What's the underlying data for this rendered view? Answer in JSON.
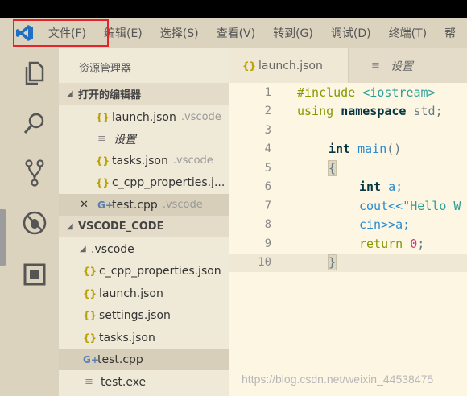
{
  "menu": {
    "items": [
      "文件(F)",
      "编辑(E)",
      "选择(S)",
      "查看(V)",
      "转到(G)",
      "调试(D)",
      "终端(T)",
      "帮"
    ]
  },
  "sidebar": {
    "title": "资源管理器",
    "open_editors_section": "打开的编辑器",
    "open_editors": [
      {
        "icon": "json-icon",
        "name": "launch.json",
        "folder": ".vscode"
      },
      {
        "icon": "settings-file-icon",
        "name": "设置",
        "folder": ""
      },
      {
        "icon": "json-icon",
        "name": "tasks.json",
        "folder": ".vscode"
      },
      {
        "icon": "json-icon",
        "name": "c_cpp_properties.j...",
        "folder": ""
      },
      {
        "icon": "cpp-icon",
        "name": "test.cpp",
        "folder": ".vscode"
      }
    ],
    "workspace_section": "VSCODE_CODE",
    "tree": [
      {
        "name": ".vscode"
      },
      {
        "icon": "json-icon",
        "name": "c_cpp_properties.json"
      },
      {
        "icon": "json-icon",
        "name": "launch.json"
      },
      {
        "icon": "json-icon",
        "name": "settings.json"
      },
      {
        "icon": "json-icon",
        "name": "tasks.json"
      },
      {
        "icon": "cpp-icon",
        "name": "test.cpp"
      },
      {
        "icon": "file-lines-icon",
        "name": "test.exe"
      }
    ]
  },
  "tabs": [
    {
      "icon": "json-icon",
      "label": "launch.json"
    },
    {
      "icon": "settings-file-icon",
      "label": "设置"
    }
  ],
  "code": {
    "line_numbers": [
      "1",
      "2",
      "3",
      "4",
      "5",
      "6",
      "7",
      "8",
      "9",
      "10"
    ],
    "lines": {
      "l1_pre": "#include ",
      "l1_hdr": "<iostream>",
      "l2_kw1": "using ",
      "l2_kw2": "namespace ",
      "l2_rest": "std;",
      "l4_type": "int ",
      "l4_fn": "main",
      "l4_rest": "()",
      "l5_brace": "{",
      "l6_type": "int ",
      "l6_rest": "a;",
      "l7_plain": "cout<<",
      "l7_str": "\"Hello W",
      "l8_plain": "cin>>a;",
      "l9_kw": "return ",
      "l9_num": "0",
      "l9_rest": ";",
      "l10_brace": "}"
    }
  },
  "watermark": "https://blog.csdn.net/weixin_44538475",
  "colors": {
    "highlight_box": "#e3252b",
    "vscode_blue": "#1f6fc4"
  }
}
